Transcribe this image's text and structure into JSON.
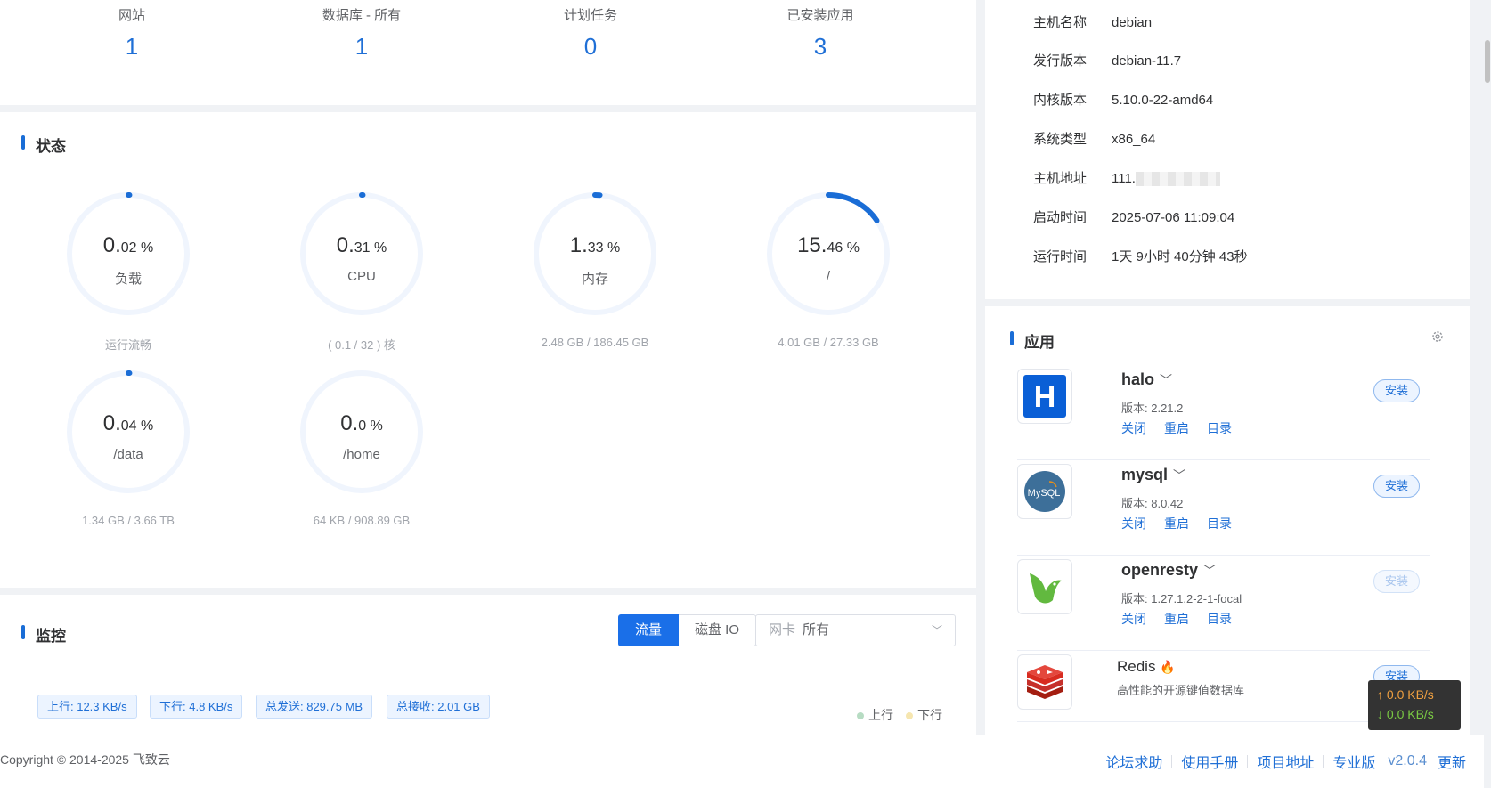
{
  "stats": [
    {
      "label": "网站",
      "value": "1"
    },
    {
      "label": "数据库 - 所有",
      "value": "1"
    },
    {
      "label": "计划任务",
      "value": "0"
    },
    {
      "label": "已安装应用",
      "value": "3"
    }
  ],
  "status": {
    "title": "状态",
    "gauges": [
      {
        "int": "0.",
        "dec": "02 %",
        "name": "负载",
        "sub": "运行流畅",
        "percent": 0.02
      },
      {
        "int": "0.",
        "dec": "31 %",
        "name": "CPU",
        "sub": "( 0.1 / 32 ) 核",
        "percent": 0.31
      },
      {
        "int": "1.",
        "dec": "33 %",
        "name": "内存",
        "sub": "2.48 GB / 186.45 GB",
        "percent": 1.33
      },
      {
        "int": "15.",
        "dec": "46 %",
        "name": "/",
        "sub": "4.01 GB / 27.33 GB",
        "percent": 15.46
      },
      {
        "int": "0.",
        "dec": "04 %",
        "name": "/data",
        "sub": "1.34 GB / 3.66 TB",
        "percent": 0.04
      },
      {
        "int": "0.",
        "dec": "0 %",
        "name": "/home",
        "sub": "64 KB / 908.89 GB",
        "percent": 0.0
      }
    ],
    "colors": {
      "arc": "#1a6dd6",
      "track": "#f0f5fd"
    }
  },
  "monitor": {
    "title": "监控",
    "tabs": [
      "流量",
      "磁盘 IO"
    ],
    "active_tab": "流量",
    "select_prefix": "网卡",
    "select_value": "所有",
    "tags": [
      "上行: 12.3 KB/s",
      "下行: 4.8 KB/s",
      "总发送: 829.75 MB",
      "总接收: 2.01 GB"
    ],
    "legend": [
      "上行",
      "下行"
    ]
  },
  "system": {
    "rows": [
      {
        "key": "主机名称",
        "value": "debian"
      },
      {
        "key": "发行版本",
        "value": "debian-11.7"
      },
      {
        "key": "内核版本",
        "value": "5.10.0-22-amd64"
      },
      {
        "key": "系统类型",
        "value": "x86_64"
      },
      {
        "key": "主机地址",
        "value": "111."
      },
      {
        "key": "启动时间",
        "value": "2025-07-06 11:09:04"
      },
      {
        "key": "运行时间",
        "value": "1天 9小时 40分钟 43秒"
      }
    ]
  },
  "apps": {
    "title": "应用",
    "actions": [
      "关闭",
      "重启",
      "目录"
    ],
    "items": [
      {
        "name": "halo",
        "version": "版本: 2.21.2",
        "button": "安装",
        "icon": "halo-logo-icon"
      },
      {
        "name": "mysql",
        "version": "版本: 8.0.42",
        "button": "安装",
        "icon": "mysql-logo-icon"
      },
      {
        "name": "openresty",
        "version": "版本: 1.27.1.2-2-1-focal",
        "button": "安装",
        "icon": "openresty-logo-icon"
      }
    ],
    "redis": {
      "name": "Redis",
      "desc": "高性能的开源键值数据库",
      "button": "安装",
      "icon": "redis-logo-icon"
    }
  },
  "net_popup": {
    "up": "↑ 0.0 KB/s",
    "down": "↓ 0.0 KB/s"
  },
  "footer": {
    "copyright": "Copyright © 2014-2025 飞致云",
    "links": [
      "论坛求助",
      "使用手册",
      "项目地址",
      "专业版"
    ],
    "version": "v2.0.4",
    "update": "更新"
  }
}
